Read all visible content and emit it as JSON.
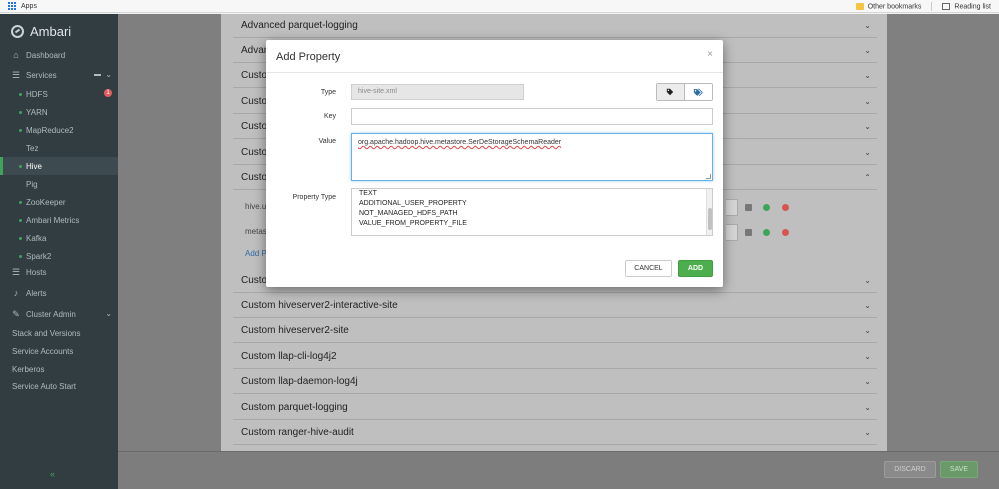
{
  "browser": {
    "apps_label": "Apps",
    "other_bookmarks": "Other bookmarks",
    "reading_list": "Reading list"
  },
  "sidebar": {
    "brand": "Ambari",
    "dashboard": "Dashboard",
    "services": "Services",
    "service_items": [
      {
        "label": "HDFS",
        "status": "green",
        "alerts": "1"
      },
      {
        "label": "YARN",
        "status": "green"
      },
      {
        "label": "MapReduce2",
        "status": "green"
      },
      {
        "label": "Tez",
        "status": "none"
      },
      {
        "label": "Hive",
        "status": "green",
        "active": true
      },
      {
        "label": "Pig",
        "status": "none"
      },
      {
        "label": "ZooKeeper",
        "status": "green"
      },
      {
        "label": "Ambari Metrics",
        "status": "green"
      },
      {
        "label": "Kafka",
        "status": "green"
      },
      {
        "label": "Spark2",
        "status": "green"
      }
    ],
    "hosts": "Hosts",
    "alerts": "Alerts",
    "cluster_admin": "Cluster Admin",
    "admin_items": [
      "Stack and Versions",
      "Service Accounts",
      "Kerberos",
      "Service Auto Start"
    ],
    "collapse": "«"
  },
  "sections": [
    "Advanced parquet-logging",
    "Advan",
    "Custo",
    "Custo",
    "Custo",
    "Custo",
    "Custo",
    "Custo",
    "Custom hiveserver2-interactive-site",
    "Custom hiveserver2-site",
    "Custom llap-cli-log4j2",
    "Custom llap-daemon-log4j",
    "Custom parquet-logging",
    "Custom ranger-hive-audit"
  ],
  "behind": {
    "row1": "hive.us",
    "row2": "metas",
    "add_link": "Add Pr"
  },
  "modal": {
    "title": "Add Property",
    "close": "×",
    "type_label": "Type",
    "type_value": "hive-site.xml",
    "key_label": "Key",
    "key_value": "",
    "value_label": "Value",
    "value_text": "org.apache.hadoop.hive.metastore.SerDeStorageSchemaReader",
    "property_type_label": "Property Type",
    "property_type_options": [
      "TEXT",
      "ADDITIONAL_USER_PROPERTY",
      "NOT_MANAGED_HDFS_PATH",
      "VALUE_FROM_PROPERTY_FILE"
    ],
    "cancel": "CANCEL",
    "add": "ADD"
  },
  "footer": {
    "discard": "DISCARD",
    "save": "SAVE"
  },
  "colors": {
    "sidebar_bg": "#313d41",
    "accent_green": "#3fa35b",
    "add_button": "#4cae4c",
    "focus_blue": "#66afe9"
  }
}
